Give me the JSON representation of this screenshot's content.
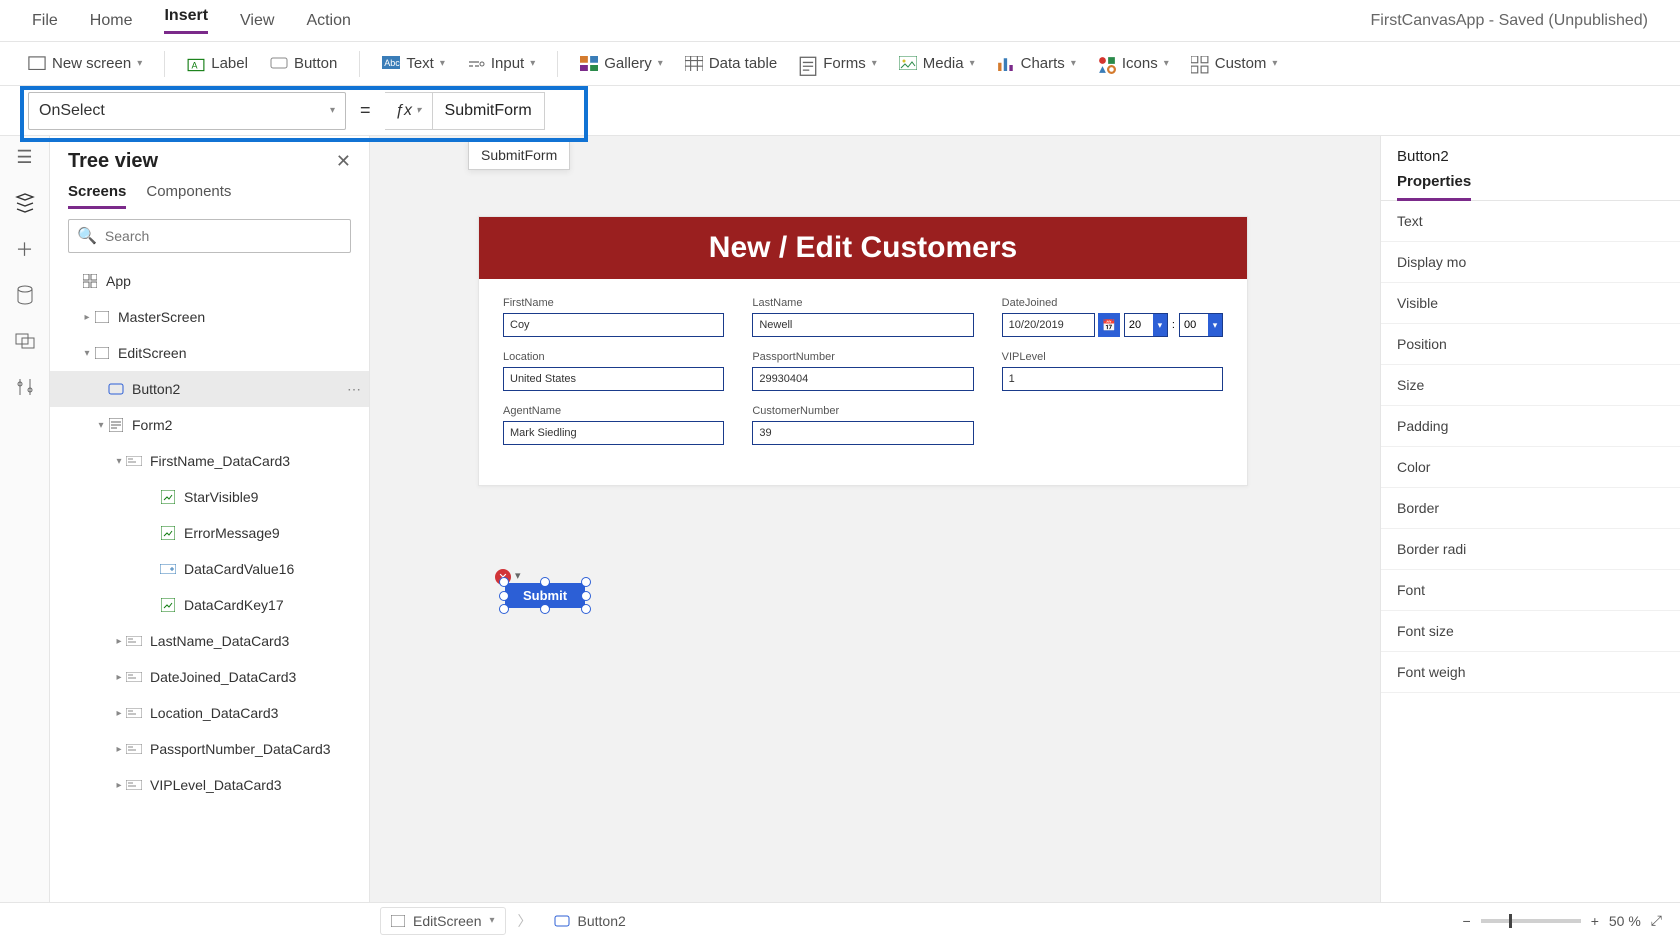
{
  "app_title": "FirstCanvasApp - Saved (Unpublished)",
  "top_menu": {
    "items": [
      "File",
      "Home",
      "Insert",
      "View",
      "Action"
    ],
    "active": "Insert"
  },
  "ribbon": {
    "new_screen": "New screen",
    "label": "Label",
    "button": "Button",
    "text": "Text",
    "input": "Input",
    "gallery": "Gallery",
    "data_table": "Data table",
    "forms": "Forms",
    "media": "Media",
    "charts": "Charts",
    "icons": "Icons",
    "custom": "Custom"
  },
  "formula": {
    "property": "OnSelect",
    "value": "SubmitForm"
  },
  "intellisense": "SubmitForm",
  "tree": {
    "title": "Tree view",
    "tabs": {
      "screens": "Screens",
      "components": "Components"
    },
    "search_placeholder": "Search",
    "nodes": {
      "app": "App",
      "master": "MasterScreen",
      "edit": "EditScreen",
      "button2": "Button2",
      "form2": "Form2",
      "firstname_card": "FirstName_DataCard3",
      "starvisible": "StarVisible9",
      "errormsg": "ErrorMessage9",
      "datacardvalue": "DataCardValue16",
      "datacardkey": "DataCardKey17",
      "lastname_card": "LastName_DataCard3",
      "datejoined_card": "DateJoined_DataCard3",
      "location_card": "Location_DataCard3",
      "passport_card": "PassportNumber_DataCard3",
      "viplevel_card": "VIPLevel_DataCard3"
    }
  },
  "canvas_form": {
    "header": "New / Edit Customers",
    "fields": {
      "firstname": {
        "label": "FirstName",
        "value": "Coy"
      },
      "lastname": {
        "label": "LastName",
        "value": "Newell"
      },
      "datejoined": {
        "label": "DateJoined",
        "date": "10/20/2019",
        "hour": "20",
        "min": "00"
      },
      "location": {
        "label": "Location",
        "value": "United States"
      },
      "passport": {
        "label": "PassportNumber",
        "value": "29930404"
      },
      "viplevel": {
        "label": "VIPLevel",
        "value": "1"
      },
      "agent": {
        "label": "AgentName",
        "value": "Mark Siedling"
      },
      "customer": {
        "label": "CustomerNumber",
        "value": "39"
      }
    },
    "submit_label": "Submit"
  },
  "properties": {
    "selected": "Button2",
    "tab": "Properties",
    "rows": [
      "Text",
      "Display mo",
      "Visible",
      "Position",
      "Size",
      "Padding",
      "Color",
      "Border",
      "Border radi",
      "Font",
      "Font size",
      "Font weigh"
    ]
  },
  "status": {
    "screen": "EditScreen",
    "control": "Button2",
    "zoom": "50  %"
  }
}
